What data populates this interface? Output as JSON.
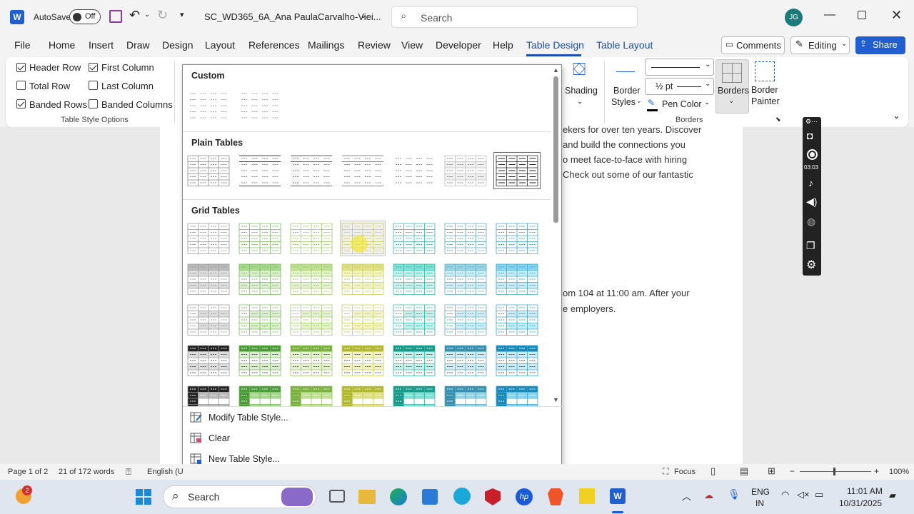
{
  "titlebar": {
    "autosave_label": "AutoSave",
    "autosave_state": "Off",
    "doc_name": "SC_WD365_6A_Ana PaulaCarvalho-Viei...",
    "search_placeholder": "Search",
    "user_initials": "JG"
  },
  "tabs": [
    "File",
    "Home",
    "Insert",
    "Draw",
    "Design",
    "Layout",
    "References",
    "Mailings",
    "Review",
    "View",
    "Developer",
    "Help",
    "Table Design",
    "Table Layout"
  ],
  "right_buttons": {
    "comments": "Comments",
    "editing": "Editing",
    "share": "Share"
  },
  "style_options": {
    "header_row": "Header Row",
    "first_column": "First Column",
    "total_row": "Total Row",
    "last_column": "Last Column",
    "banded_rows": "Banded Rows",
    "banded_columns": "Banded Columns",
    "group": "Table Style Options"
  },
  "borders": {
    "shading": "Shading",
    "border_styles_1": "Border",
    "border_styles_2": "Styles",
    "weight": "½ pt",
    "pen_color": "Pen Color",
    "borders_btn": "Borders",
    "painter_1": "Border",
    "painter_2": "Painter",
    "group": "Borders"
  },
  "gallery": {
    "custom": "Custom",
    "plain": "Plain Tables",
    "grid": "Grid Tables",
    "modify": "Modify Table Style...",
    "clear": "Clear",
    "new": "New Table Style..."
  },
  "document": {
    "line1": "ekers for over ten years. Discover",
    "line2": "and build the connections you",
    "line3": "o meet face-to-face with hiring",
    "line4": "Check out some of our fantastic",
    "line5": "om 104 at 11:00 am. After your",
    "line6": "e employers."
  },
  "recorder": {
    "time": "03:03"
  },
  "status": {
    "page": "Page 1 of 2",
    "words": "21 of 172 words",
    "lang": "English (U",
    "focus": "Focus",
    "zoom": "100%"
  },
  "taskbar": {
    "search": "Search",
    "lang1": "ENG",
    "lang2": "IN",
    "time": "11:01 AM",
    "date": "10/31/2025",
    "badge": "2"
  },
  "colors": {
    "accent": "#1a4fb3",
    "share": "#1f5fd1",
    "avatar": "#1b7a7a"
  }
}
